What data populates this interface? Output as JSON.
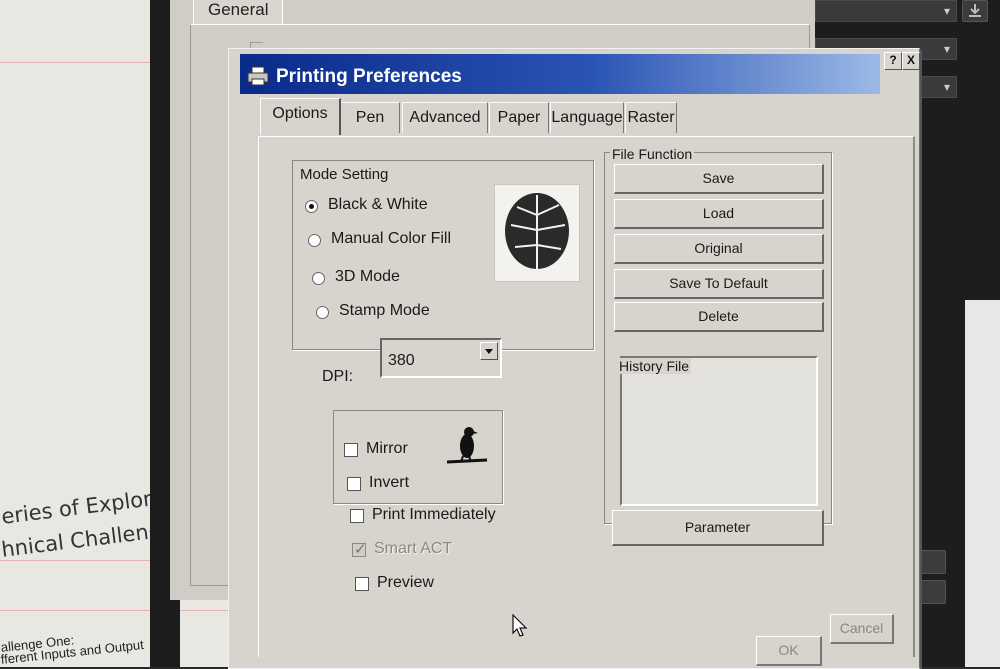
{
  "background_doc": {
    "line1": "eries of Exploratio",
    "line2": "hnical Challenges.",
    "line3": "allenge One:",
    "line4": "fferent Inputs and Output"
  },
  "back_dialog": {
    "tab_label": "General"
  },
  "dialog": {
    "title": "Printing Preferences",
    "help_button": "?",
    "close_button": "X",
    "title_gradient_start": "#0a2a8a",
    "title_gradient_end": "#9cb9e6"
  },
  "tabs": [
    {
      "label": "Options",
      "active": true
    },
    {
      "label": "Pen"
    },
    {
      "label": "Advanced"
    },
    {
      "label": "Paper"
    },
    {
      "label": "Language"
    },
    {
      "label": "Raster"
    }
  ],
  "mode_setting": {
    "legend": "Mode Setting",
    "options": [
      {
        "label": "Black & White",
        "selected": true
      },
      {
        "label": "Manual Color Fill",
        "selected": false
      },
      {
        "label": "3D Mode",
        "selected": false
      },
      {
        "label": "Stamp Mode",
        "selected": false
      }
    ],
    "preview_icon": "leaf-icon"
  },
  "dpi": {
    "label": "DPI:",
    "value": "380"
  },
  "transform": {
    "mirror_label": "Mirror",
    "mirror_checked": false,
    "invert_label": "Invert",
    "invert_checked": false,
    "preview_icon": "bird-icon"
  },
  "options": {
    "print_immediately_label": "Print Immediately",
    "print_immediately_checked": false,
    "smart_act_label": "Smart ACT",
    "smart_act_checked": true,
    "smart_act_disabled": true,
    "preview_label": "Preview",
    "preview_checked": false
  },
  "file_function": {
    "legend": "File Function",
    "buttons": [
      "Save",
      "Load",
      "Original",
      "Save To Default",
      "Delete"
    ],
    "history_label": "History File",
    "parameter_button": "Parameter"
  },
  "footer": {
    "ok_label": "OK",
    "cancel_label": "Cancel"
  }
}
